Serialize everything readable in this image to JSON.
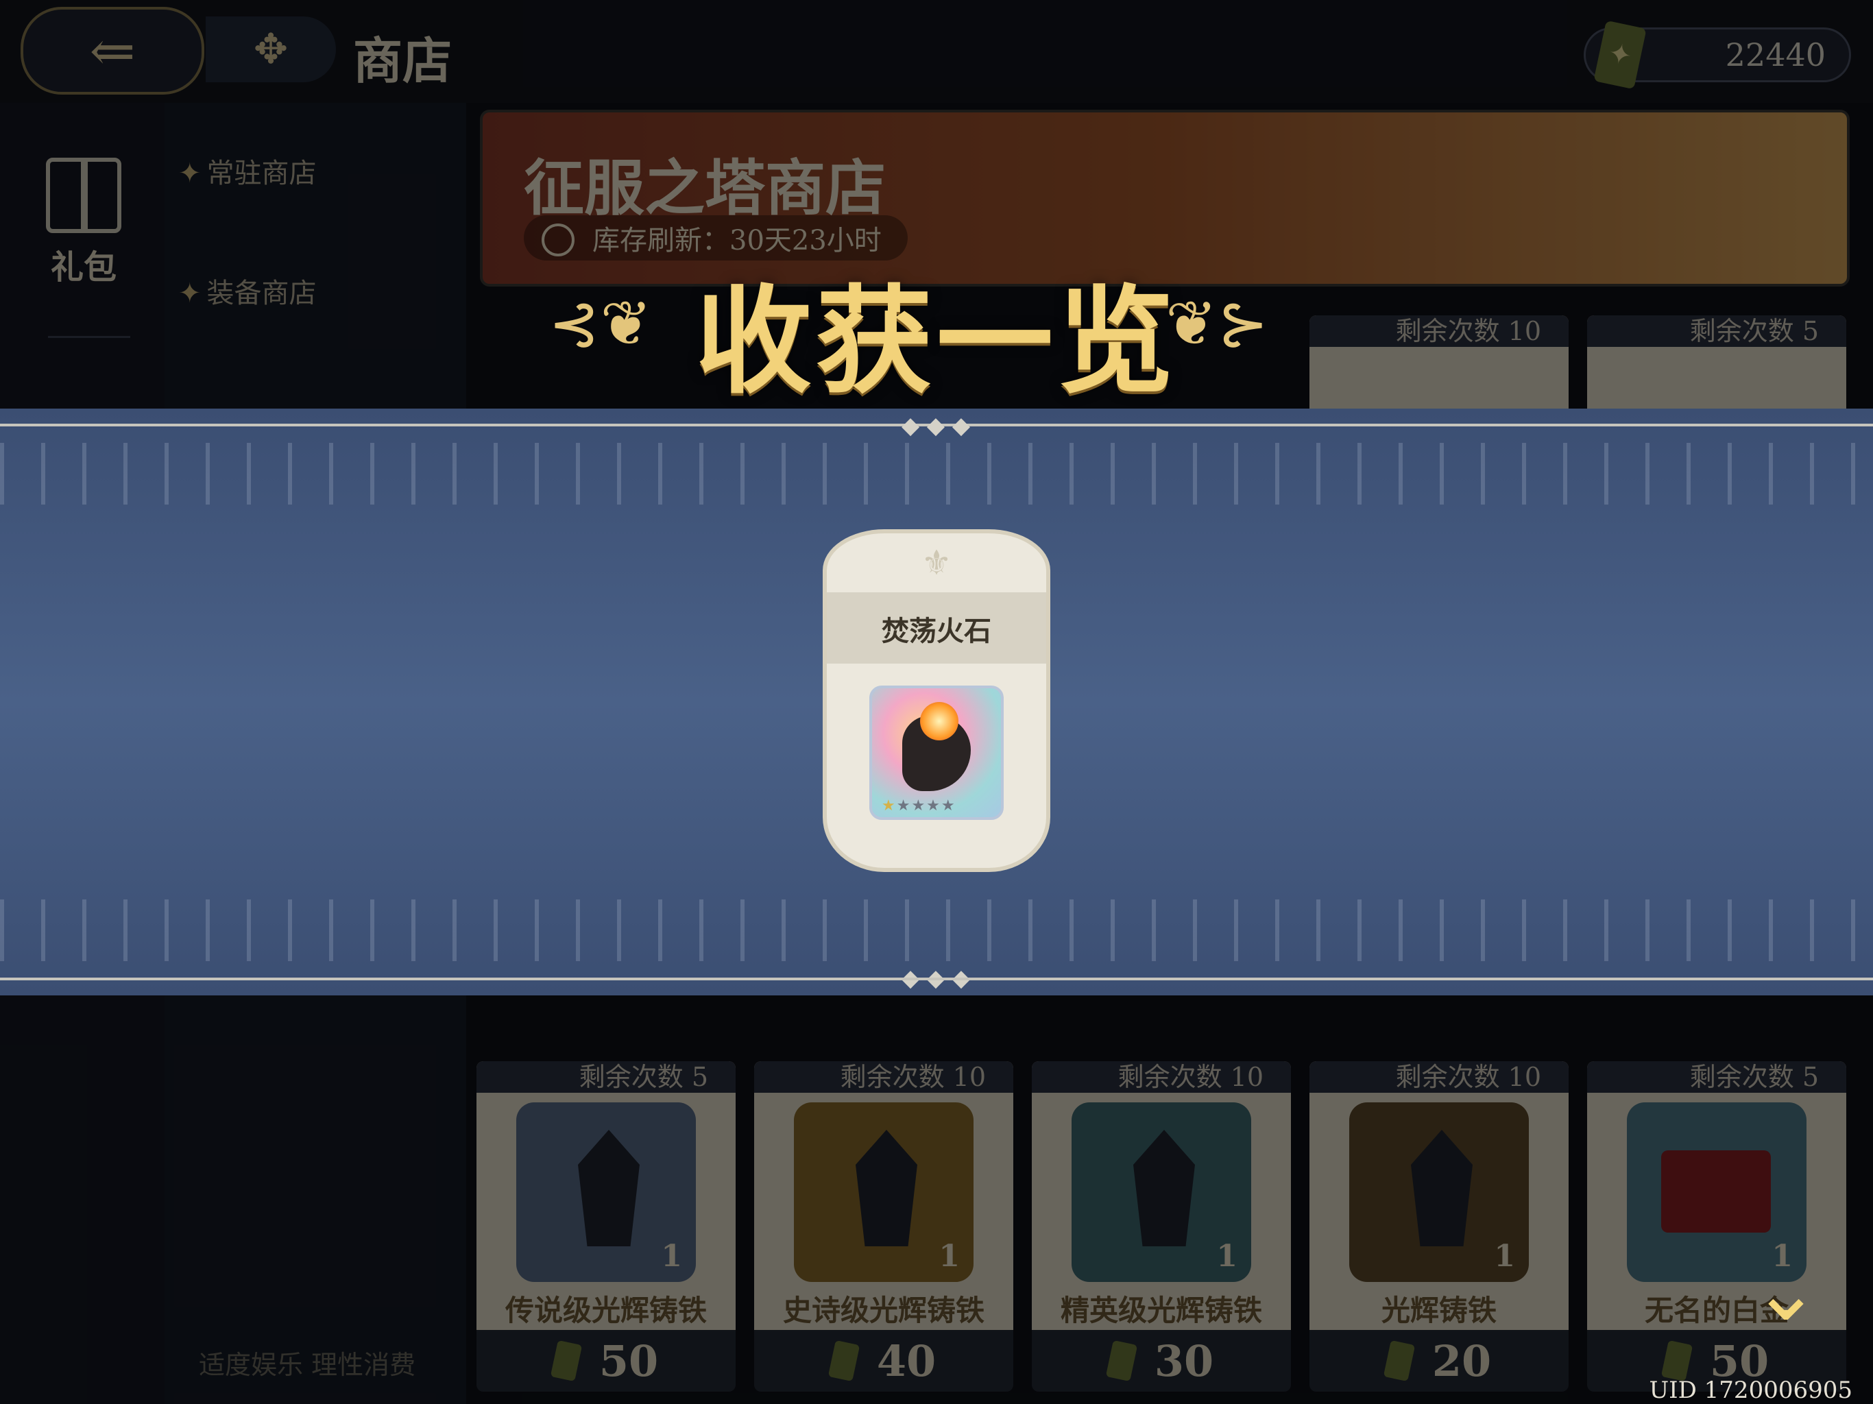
{
  "header": {
    "page_title": "商店",
    "currency_value": "22440"
  },
  "left": {
    "gift_label": "礼包"
  },
  "nav": {
    "items": [
      "常驻商店",
      "装备商店"
    ]
  },
  "banner": {
    "title": "征服之塔商店",
    "refresh": "库存刷新：30天23小时"
  },
  "shop": {
    "cards": [
      {
        "remaining": "剩余次数 5",
        "name": "传说级光辉铸铁",
        "qty": "1",
        "price": "50",
        "color": "#5a6e8a"
      },
      {
        "remaining": "剩余次数 10",
        "name": "史诗级光辉铸铁",
        "qty": "1",
        "price": "40",
        "color": "#8a6a2a"
      },
      {
        "remaining": "剩余次数 10",
        "name": "精英级光辉铸铁",
        "qty": "1",
        "price": "30",
        "color": "#3f6a72"
      },
      {
        "remaining": "剩余次数 10",
        "name": "光辉铸铁",
        "qty": "1",
        "price": "20",
        "color": "#5e4a2a"
      },
      {
        "remaining": "剩余次数 5",
        "name": "无名的白金",
        "qty": "1",
        "price": "50",
        "color": "#4f7a8a"
      }
    ],
    "top_row_remaining": [
      "剩余次数 10",
      "剩余次数 5"
    ]
  },
  "modal": {
    "title": "收获一览",
    "reward_name": "焚荡火石",
    "reward_stars_filled": 1,
    "reward_stars_total": 5
  },
  "footer": {
    "note": "适度娱乐 理性消费",
    "uid": "UID 1720006905"
  }
}
